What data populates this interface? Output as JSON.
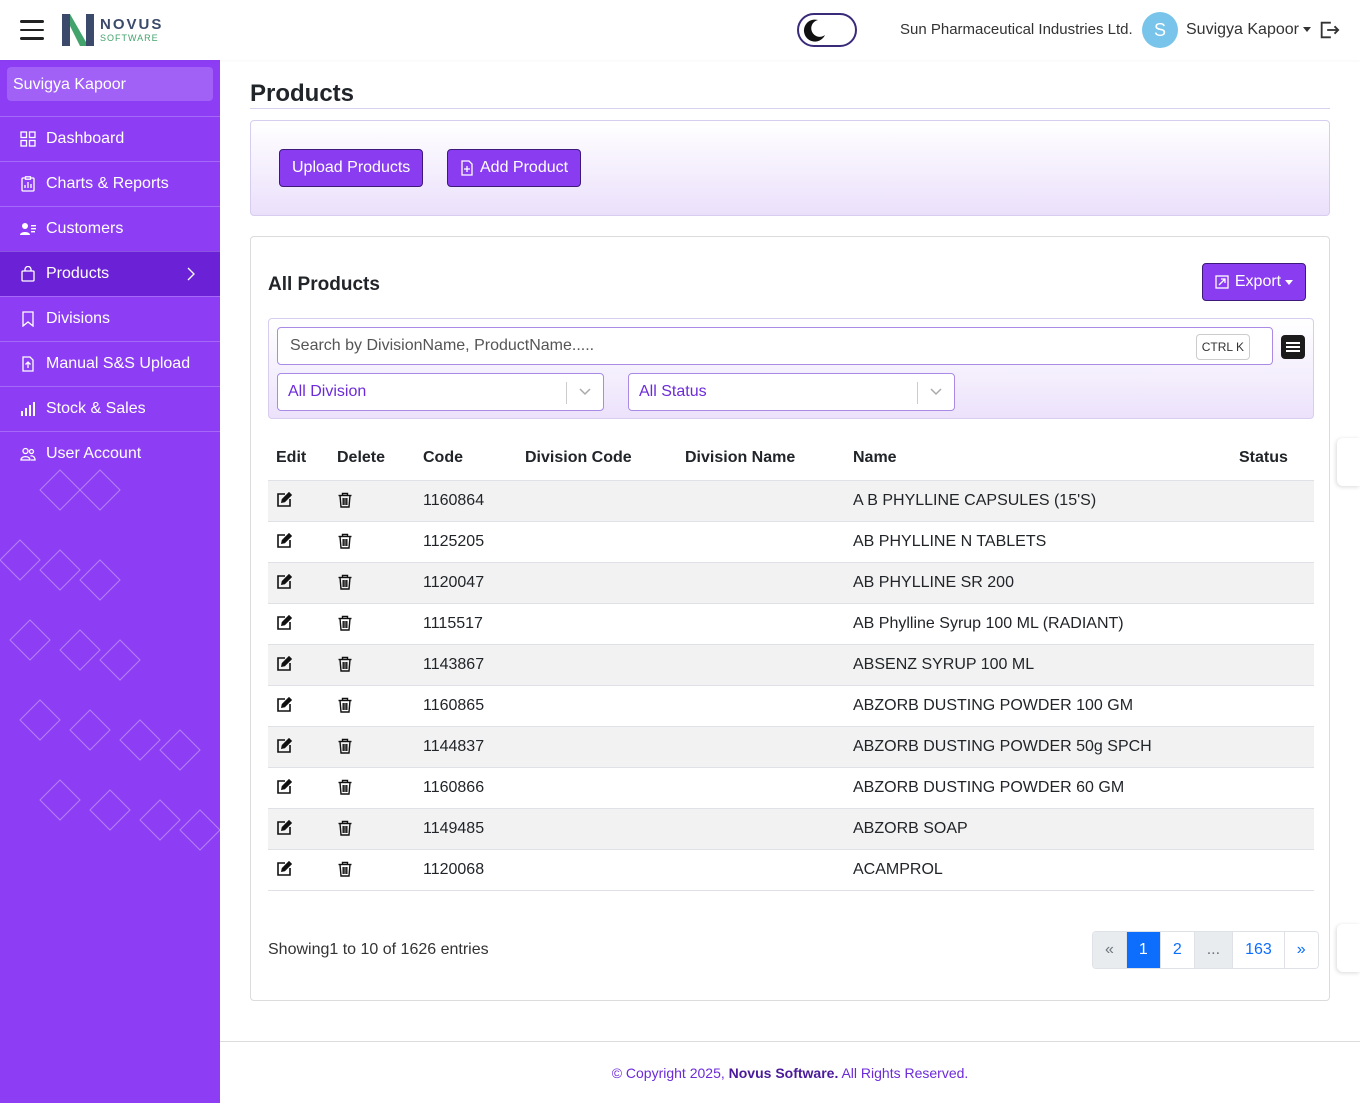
{
  "header": {
    "logo_line1": "NOVUS",
    "logo_line2": "SOFTWARE",
    "company": "Sun Pharmaceutical Industries Ltd.",
    "avatar_initial": "S",
    "user_name": "Suvigya Kapoor"
  },
  "sidebar": {
    "user_name": "Suvigya Kapoor",
    "items": [
      {
        "label": "Dashboard",
        "icon": "grid-icon"
      },
      {
        "label": "Charts & Reports",
        "icon": "report-icon"
      },
      {
        "label": "Customers",
        "icon": "customers-icon"
      },
      {
        "label": "Products",
        "icon": "bag-icon",
        "active": true
      },
      {
        "label": "Divisions",
        "icon": "bookmark-icon"
      },
      {
        "label": "Manual S&S Upload",
        "icon": "upload-file-icon"
      },
      {
        "label": "Stock & Sales",
        "icon": "bar-chart-icon"
      },
      {
        "label": "User Account",
        "icon": "users-icon"
      }
    ]
  },
  "page": {
    "title": "Products",
    "upload_label": "Upload Products",
    "add_label": "Add Product",
    "section_title": "All Products",
    "export_label": "Export",
    "search_placeholder": "Search by DivisionName, ProductName.....",
    "shortcut": "CTRL K",
    "division_filter": "All Division",
    "status_filter": "All Status"
  },
  "table": {
    "headers": [
      "Edit",
      "Delete",
      "Code",
      "Division Code",
      "Division Name",
      "Name",
      "Status"
    ],
    "rows": [
      {
        "code": "1160864",
        "division_code": "",
        "division_name": "",
        "name": "A B PHYLLINE CAPSULES (15'S)",
        "status": ""
      },
      {
        "code": "1125205",
        "division_code": "",
        "division_name": "",
        "name": "AB PHYLLINE N TABLETS",
        "status": ""
      },
      {
        "code": "1120047",
        "division_code": "",
        "division_name": "",
        "name": "AB PHYLLINE SR 200",
        "status": ""
      },
      {
        "code": "1115517",
        "division_code": "",
        "division_name": "",
        "name": "AB Phylline Syrup 100 ML (RADIANT)",
        "status": ""
      },
      {
        "code": "1143867",
        "division_code": "",
        "division_name": "",
        "name": "ABSENZ SYRUP 100 ML",
        "status": ""
      },
      {
        "code": "1160865",
        "division_code": "",
        "division_name": "",
        "name": "ABZORB DUSTING POWDER 100 GM",
        "status": ""
      },
      {
        "code": "1144837",
        "division_code": "",
        "division_name": "",
        "name": "ABZORB DUSTING POWDER 50g SPCH",
        "status": ""
      },
      {
        "code": "1160866",
        "division_code": "",
        "division_name": "",
        "name": "ABZORB DUSTING POWDER 60 GM",
        "status": ""
      },
      {
        "code": "1149485",
        "division_code": "",
        "division_name": "",
        "name": "ABZORB SOAP",
        "status": ""
      },
      {
        "code": "1120068",
        "division_code": "",
        "division_name": "",
        "name": "ACAMPROL",
        "status": ""
      }
    ]
  },
  "pagination": {
    "showing": "Showing1 to 10 of 1626 entries",
    "prev": "«",
    "pages": [
      "1",
      "2",
      "...",
      "163"
    ],
    "next": "»",
    "active_page": "1"
  },
  "footer": {
    "prefix": "© Copyright 2025, ",
    "brand": "Novus Software.",
    "suffix": " All Rights Reserved."
  },
  "colors": {
    "sidebar": "#8d3ef5",
    "sidebar_active": "#6b21d6",
    "button": "#8a3df0",
    "pagination_active": "#0d6efd"
  }
}
